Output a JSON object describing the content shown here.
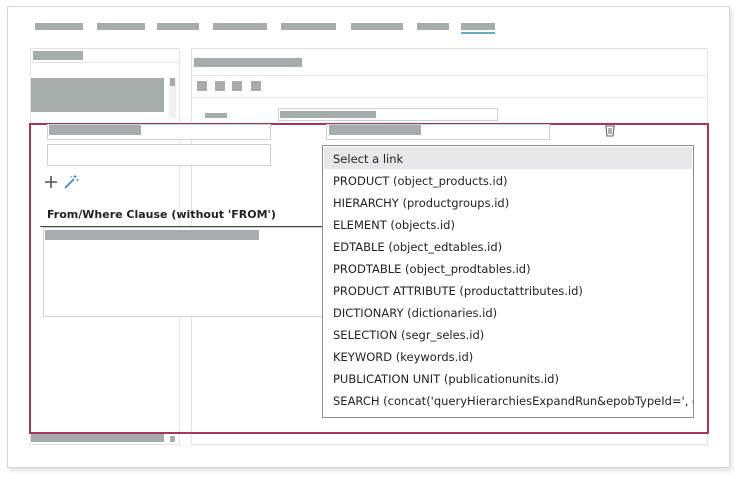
{
  "clause": {
    "label": "From/Where Clause (without 'FROM')"
  },
  "link_dropdown": {
    "items": [
      "Select a link",
      "PRODUCT (object_products.id)",
      "HIERARCHY (productgroups.id)",
      "ELEMENT (objects.id)",
      "EDTABLE (object_edtables.id)",
      "PRODTABLE (object_prodtables.id)",
      "PRODUCT ATTRIBUTE (productattributes.id)",
      "DICTIONARY (dictionaries.id)",
      "SELECTION (segr_seles.id)",
      "KEYWORD (keywords.id)",
      "PUBLICATION UNIT (publicationunits.id)",
      "SEARCH (concat('queryHierarchiesExpandRun&epobTypeId=', obj"
    ]
  },
  "icons": {
    "add": "plus-icon",
    "wand": "magic-wand-icon",
    "delete": "trash-icon"
  }
}
